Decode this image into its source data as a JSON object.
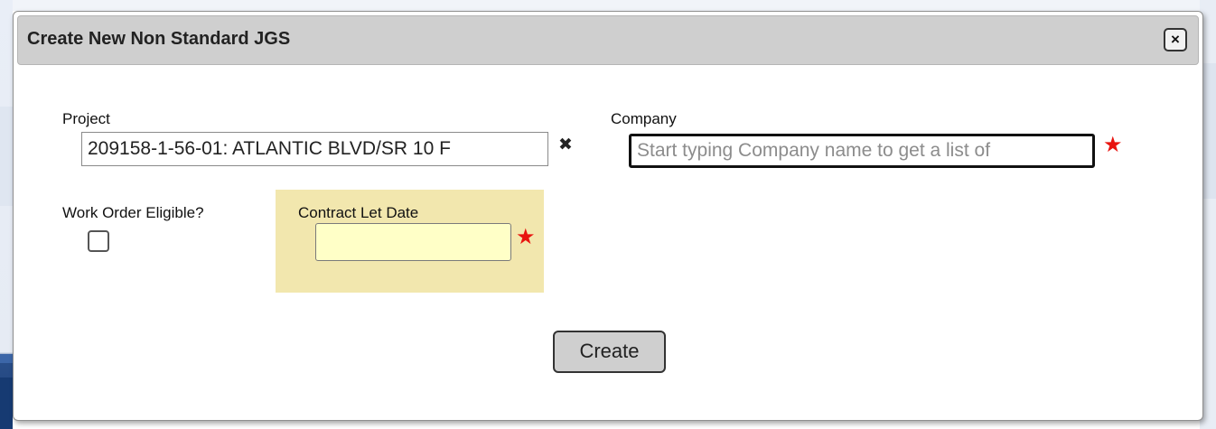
{
  "dialog": {
    "title": "Create New Non Standard JGS",
    "close_glyph": "×"
  },
  "fields": {
    "project": {
      "label": "Project",
      "value": "209158-1-56-01: ATLANTIC BLVD/SR 10 F",
      "clear_glyph": "✖"
    },
    "company": {
      "label": "Company",
      "placeholder": "Start typing Company name to get a list of",
      "required_glyph": "★"
    },
    "work_order": {
      "label": "Work Order Eligible?",
      "checked": false
    },
    "contract_let_date": {
      "label": "Contract Let Date",
      "value": "",
      "required_glyph": "★"
    }
  },
  "actions": {
    "create_label": "Create"
  },
  "colors": {
    "required": "#e8140f",
    "date_panel": "#f2e7ae",
    "date_input": "#ffffc7",
    "titlebar": "#cfcfcf"
  }
}
